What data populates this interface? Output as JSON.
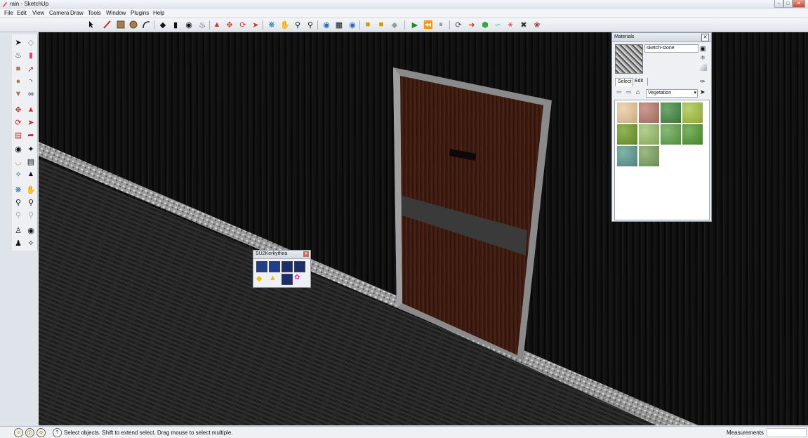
{
  "window": {
    "title": "rain - SketchUp",
    "app_icon": "sketchup-icon",
    "controls": [
      "minimize-icon",
      "maximize-icon",
      "close-icon"
    ]
  },
  "menu": [
    "File",
    "Edit",
    "View",
    "Camera",
    "Draw",
    "Tools",
    "Window",
    "Plugins",
    "Help"
  ],
  "materials": {
    "title": "Materials",
    "current_name": "sketch-stone",
    "tabs": [
      "Select",
      "Edit"
    ],
    "active_tab": "Select",
    "library": "Vegetation",
    "swatch_colors": [
      "#e9c99a",
      "#b97a6c",
      "#3f8a3d",
      "#a5c33f",
      "#6e9b24",
      "#9bbf6a",
      "#5ea34a",
      "#4f9a2d",
      "#5a9a8e",
      "#7aa35c"
    ]
  },
  "kerkythea": {
    "title": "SU2Kerkythea"
  },
  "status": {
    "message": "Select objects. Shift to extend select. Drag mouse to select multiple.",
    "measurements_label": "Measurements",
    "measurements_value": ""
  }
}
